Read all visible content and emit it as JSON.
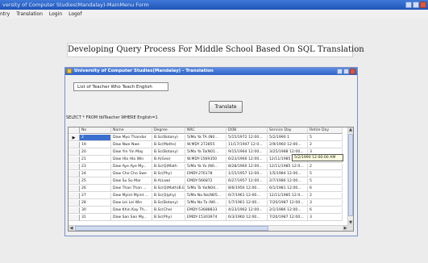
{
  "main_window": {
    "title": "versity of Computer Studies(Mandalay)-MainMenu Form",
    "menu": [
      "ntry",
      "Translation",
      "Login",
      "Logof"
    ]
  },
  "banner": "Developing Query Process For Middle School Based On SQL Translation",
  "translation_window": {
    "title": "University of Computer Studies(Mandalay) - Translation",
    "query_input_value": "List of Teacher Who Teach English",
    "translate_label": "Translate",
    "sql_output": "SELECT * FROM tblTeacher WHERE English=1"
  },
  "grid": {
    "columns": [
      "No",
      "Name",
      "Degree",
      "NRC",
      "DOB",
      "Service Day",
      "Retire Day"
    ],
    "rows": [
      [
        "2",
        "Daw Myo Thandar",
        "B.Sc(Botany)",
        "5/Ma Ya TA (N0...",
        "5/15/1972 12:00...",
        "5/2/1990 1",
        "5"
      ],
      [
        "19",
        "Daw Nwe Nwe",
        "B.Sc(Maths)",
        "W.MDY 272855",
        "11/17/1947 12:0...",
        "2/9/1960 12:00...",
        "2"
      ],
      [
        "20",
        "Daw Yin Yin May",
        "B.Sc(Botany)",
        "5/Ma Ya Ta(N01...",
        "9/15/1964 12:00...",
        "3/25/1988 12:00...",
        "3"
      ],
      [
        "21",
        "Daw Hla Hla Win",
        "B.A(Geo)",
        "W.MDY-1569350",
        "6/23/1960 12:00...",
        "12/11/1985 12:0...",
        "6"
      ],
      [
        "23",
        "Daw Aye Aye My...",
        "B.Sc(Q)Math",
        "5/Ma Ya Ya (N0...",
        "8/28/1960 12:00...",
        "12/11/1985 12:0...",
        "2"
      ],
      [
        "24",
        "Daw Cho Cho Swe",
        "B.Sc(Phy)",
        "EMDY-276178",
        "1/15/1957 12:00...",
        "1/5/1984 12:00...",
        "5"
      ],
      [
        "25",
        "Daw Su Su Mar",
        "B.A(Law)",
        "EMDY-566872",
        "6/27/1957 12:00...",
        "2/7/1986 12:00...",
        "5"
      ],
      [
        "26",
        "Daw Than Than ...",
        "B.Sc(Q)Math)B.Ed",
        "5/Ma Ta Ya(N04...",
        "8/6/1956 12:00...",
        "6/1/1981 12:00...",
        "6"
      ],
      [
        "27",
        "Daw Myint Myint ...",
        "B.Sc(Q)phy)",
        "5/Ma Na Na(N05...",
        "6/7/1961 12:00...",
        "12/11/1985 12:0...",
        "2"
      ],
      [
        "28",
        "Daw Lei Lei Win",
        "B.Sc(Botany)",
        "5/Ma Na Ta (N0...",
        "1/7/1961 12:00...",
        "7/20/1987 12:00...",
        "3"
      ],
      [
        "30",
        "Daw Khin Kay Th...",
        "B.Sc(Che)",
        "EMDY-53688833",
        "4/23/1962 12:00...",
        "2/1/1986 12:00...",
        "6"
      ],
      [
        "31",
        "Daw San San My...",
        "B.Sc(Phy)",
        "EMDY-15303974",
        "6/3/1960 12:00...",
        "7/20/1987 12:00...",
        "3"
      ]
    ],
    "tooltip": "5/2/1990 12:00:00 AM"
  }
}
